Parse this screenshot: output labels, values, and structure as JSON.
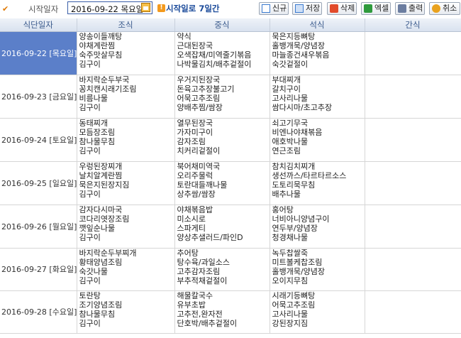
{
  "toolbar": {
    "start_label": "시작일자",
    "date_value": "2016-09-22 목요일",
    "hint": "시작일로 7일간",
    "buttons": {
      "new": "신규",
      "save": "저장",
      "delete": "삭제",
      "excel": "엑셀",
      "print": "출력",
      "cancel": "취소"
    }
  },
  "table": {
    "headers": {
      "date": "식단일자",
      "breakfast": "조식",
      "lunch": "중식",
      "dinner": "석식",
      "snack": "간식"
    },
    "rows": [
      {
        "date": "2016-09-22 [목요일]",
        "breakfast": [
          "양송이들깨탕",
          "야채계란찜",
          "숙주맛살무침",
          "김구이"
        ],
        "lunch": [
          "약식",
          "근대된장국",
          "오색잡채/미역줄기볶음",
          "나박물김치/배추겉절이"
        ],
        "dinner": [
          "묵은지등뼈탕",
          "홀뱅개묵/양념장",
          "마늘종건새우볶음",
          "숙갓겉절이"
        ],
        "snack": []
      },
      {
        "date": "2016-09-23 [금요일]",
        "breakfast": [
          "바지락순두부국",
          "꽁치캔시래기조림",
          "비름나물",
          "김구이"
        ],
        "lunch": [
          "우거지된장국",
          "돈육고추장불고기",
          "어묵고추조림",
          "양배추찜/쌈장"
        ],
        "dinner": [
          "부대찌개",
          "갈치구이",
          "고사리나물",
          "쌈다시마/초고추장"
        ],
        "snack": []
      },
      {
        "date": "2016-09-24 [토요일]",
        "breakfast": [
          "동태찌개",
          "모듬장조림",
          "참나물무침",
          "김구이"
        ],
        "lunch": [
          "열무된장국",
          "가자미구이",
          "감자조림",
          "치커리겉절이"
        ],
        "dinner": [
          "쇠고기무국",
          "비엔나야채볶음",
          "애호박나물",
          "연근조림"
        ],
        "snack": []
      },
      {
        "date": "2016-09-25 [일요일]",
        "breakfast": [
          "우렁된장찌개",
          "날치알계란찜",
          "묵은지된장지짐",
          "김구이"
        ],
        "lunch": [
          "북어채미역국",
          "오리주물럭",
          "토란대들깨나물",
          "상추쌈/쌈장"
        ],
        "dinner": [
          "참치김치찌개",
          "생선까스/타르타르소스",
          "도토리묵무침",
          "배추나물"
        ],
        "snack": []
      },
      {
        "date": "2016-09-26 [월요일]",
        "breakfast": [
          "감자다시마국",
          "코다리엿장조림",
          "깻잎순나물",
          "김구이"
        ],
        "lunch": [
          "야채볶음밥",
          "미소시로",
          "스파게티",
          "양상추샐러드/파인D"
        ],
        "dinner": [
          "홍어탕",
          "너비아니양념구이",
          "연두부/양념장",
          "청경채나물"
        ],
        "snack": []
      },
      {
        "date": "2016-09-27 [화요일]",
        "breakfast": [
          "바지락순두부찌개",
          "황태양념조림",
          "숙갓나물",
          "김구이"
        ],
        "lunch": [
          "추어탕",
          "탕수육/과일소스",
          "고추감자조림",
          "부추적채겉절이"
        ],
        "dinner": [
          "녹두찹쌀죽",
          "미트볼케찹조림",
          "홀뱅개묵/양념장",
          "오이지무침"
        ],
        "snack": []
      },
      {
        "date": "2016-09-28 [수요일]",
        "breakfast": [
          "토란탕",
          "조기양념조림",
          "참나물무침",
          "김구이"
        ],
        "lunch": [
          "해물칼국수",
          "유부초밥",
          "고추전,완자전",
          "단호박/배추겉절이"
        ],
        "dinner": [
          "시래기등뼈탕",
          "어묵고추조림",
          "고사리나물",
          "강된장지짐"
        ],
        "snack": []
      }
    ]
  }
}
